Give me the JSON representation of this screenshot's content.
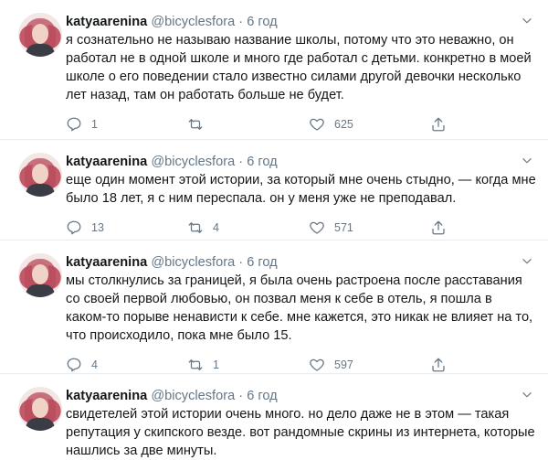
{
  "tweets": [
    {
      "name": "katyaarenina",
      "handle": "@bicyclesfora",
      "separator": "·",
      "time": "6 год",
      "text": "я сознательно не называю название школы, потому что это неважно, он работал не в одной школе и много где работал с детьми. конкретно в моей школе о его поведении стало известно силами другой девочки несколько лет назад, там он работать больше не будет.",
      "replies": "1",
      "retweets": "",
      "likes": "625"
    },
    {
      "name": "katyaarenina",
      "handle": "@bicyclesfora",
      "separator": "·",
      "time": "6 год",
      "text": "еще один момент этой истории, за который мне очень стыдно, — когда мне было 18 лет, я с ним переспала. он у меня уже не преподавал.",
      "replies": "13",
      "retweets": "4",
      "likes": "571"
    },
    {
      "name": "katyaarenina",
      "handle": "@bicyclesfora",
      "separator": "·",
      "time": "6 год",
      "text": "мы столкнулись за границей, я была очень растроена после расставания со своей первой любовью, он позвал меня к себе в отель, я пошла в каком-то порыве ненависти к себе. мне кажется, это никак не влияет на то, что происходило, пока мне было 15.",
      "replies": "4",
      "retweets": "1",
      "likes": "597"
    },
    {
      "name": "katyaarenina",
      "handle": "@bicyclesfora",
      "separator": "·",
      "time": "6 год",
      "text": "свидетелей этой истории очень много. но дело даже не в этом — такая репутация у скипского везде. вот рандомные скрины из интернета, которые нашлись за две минуты."
    }
  ],
  "icons": {
    "reply": "reply-icon",
    "retweet": "retweet-icon",
    "like": "heart-icon",
    "share": "share-icon",
    "menu": "chevron-down-icon"
  },
  "colors": {
    "text": "#14171a",
    "secondary": "#657786",
    "border": "#e6ecf0"
  }
}
